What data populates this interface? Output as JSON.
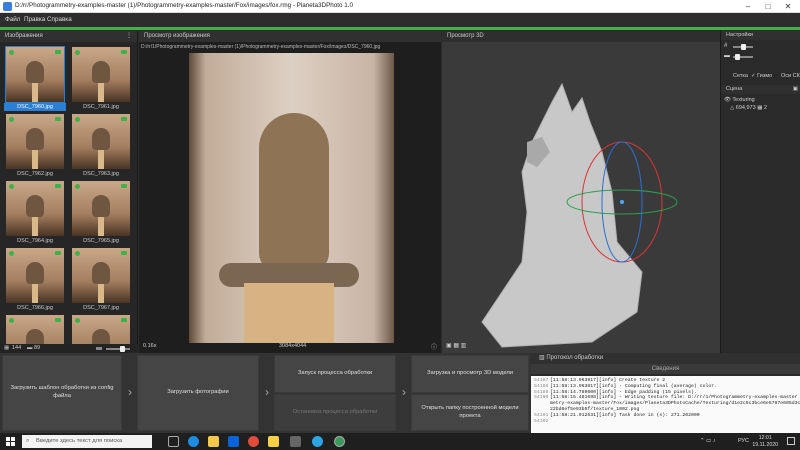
{
  "window": {
    "title": "D:/rr/Photogrammetry-examples-master (1)/Photogrammetry-examples-master/Fox/images/fox.rmg - Planeta3DPhoto 1.0"
  },
  "menu": [
    "Файл",
    "Правка",
    "Справка"
  ],
  "left_panel": {
    "title": "Изображения",
    "thumbnails": [
      {
        "name": "DSC_7960.jpg",
        "selected": true
      },
      {
        "name": "DSC_7961.jpg",
        "selected": false
      },
      {
        "name": "DSC_7962.jpg",
        "selected": false
      },
      {
        "name": "DSC_7963.jpg",
        "selected": false
      },
      {
        "name": "DSC_7964.jpg",
        "selected": false
      },
      {
        "name": "DSC_7965.jpg",
        "selected": false
      },
      {
        "name": "DSC_7966.jpg",
        "selected": false
      },
      {
        "name": "DSC_7967.jpg",
        "selected": false
      },
      {
        "name": "",
        "selected": false
      },
      {
        "name": "",
        "selected": false
      }
    ],
    "status_count_total": "144",
    "status_count_cameras": "89"
  },
  "image_view": {
    "title": "Просмотр изображения",
    "path": "D:/rr/1/Photogrammetry-examples-master (1)/Photogrammetry-examples-master/Fox/images/DSC_7960.jpg",
    "zoom": "0.16x",
    "resolution": "3084x4044"
  },
  "view3d": {
    "title": "Просмотр 3D"
  },
  "settings": {
    "title": "Настройки",
    "grid_label": "Сетка",
    "gizmo_label": "Гизмо",
    "axes_label": "Оси СК"
  },
  "scene": {
    "title": "Сцена",
    "item_label": "Texturing",
    "item_vertices": "694,973",
    "item_count": "2"
  },
  "actions": {
    "load_template": "Загрузить шаблон обработки из config файла",
    "load_photos": "Загрузить фотографии",
    "start_processing": "Запуск процесса обработки",
    "stop_processing": "Остановка процесса обработки",
    "load_view_3d": "Загрузка и просмотр 3D модели",
    "open_model_folder": "Открыть папку построенной модели проекта"
  },
  "log": {
    "title": "Протокол обработки",
    "subtitle": "Сведения",
    "lines": [
      {
        "n": "54187",
        "t": "[11:58:13.963817][info]  Create texture 2"
      },
      {
        "n": "54188",
        "t": "[11:58:13.963817][info]   - Computing final (average) color."
      },
      {
        "n": "54189",
        "t": "[11:58:14.789600][info]   - Edge padding (15 pixels)."
      },
      {
        "n": "54190",
        "t": "[11:58:15.481698][info]   - Writing texture file: D:/rr/1/Photogrammetry-examples-master (1)/Photogram"
      },
      {
        "n": "",
        "t": "metry-examples-master/Fox/images/Planeta3DPhotoCache/Texturing/d1e2c5c3bce6e5797e605d3c569"
      },
      {
        "n": "",
        "t": "22bd6ef5e93b5f/texture_1002.png"
      },
      {
        "n": "54191",
        "t": "[11:58:21.912531][info]  Task done in (s): 271.202000"
      },
      {
        "n": "54192",
        "t": ""
      }
    ]
  },
  "taskbar": {
    "search_placeholder": "Введите здесь текст для поиска",
    "language": "РУС",
    "time": "12:01",
    "date": "19.11.2020"
  },
  "colors": {
    "accent_green": "#43b04a",
    "selection_blue": "#2a7fd4"
  }
}
